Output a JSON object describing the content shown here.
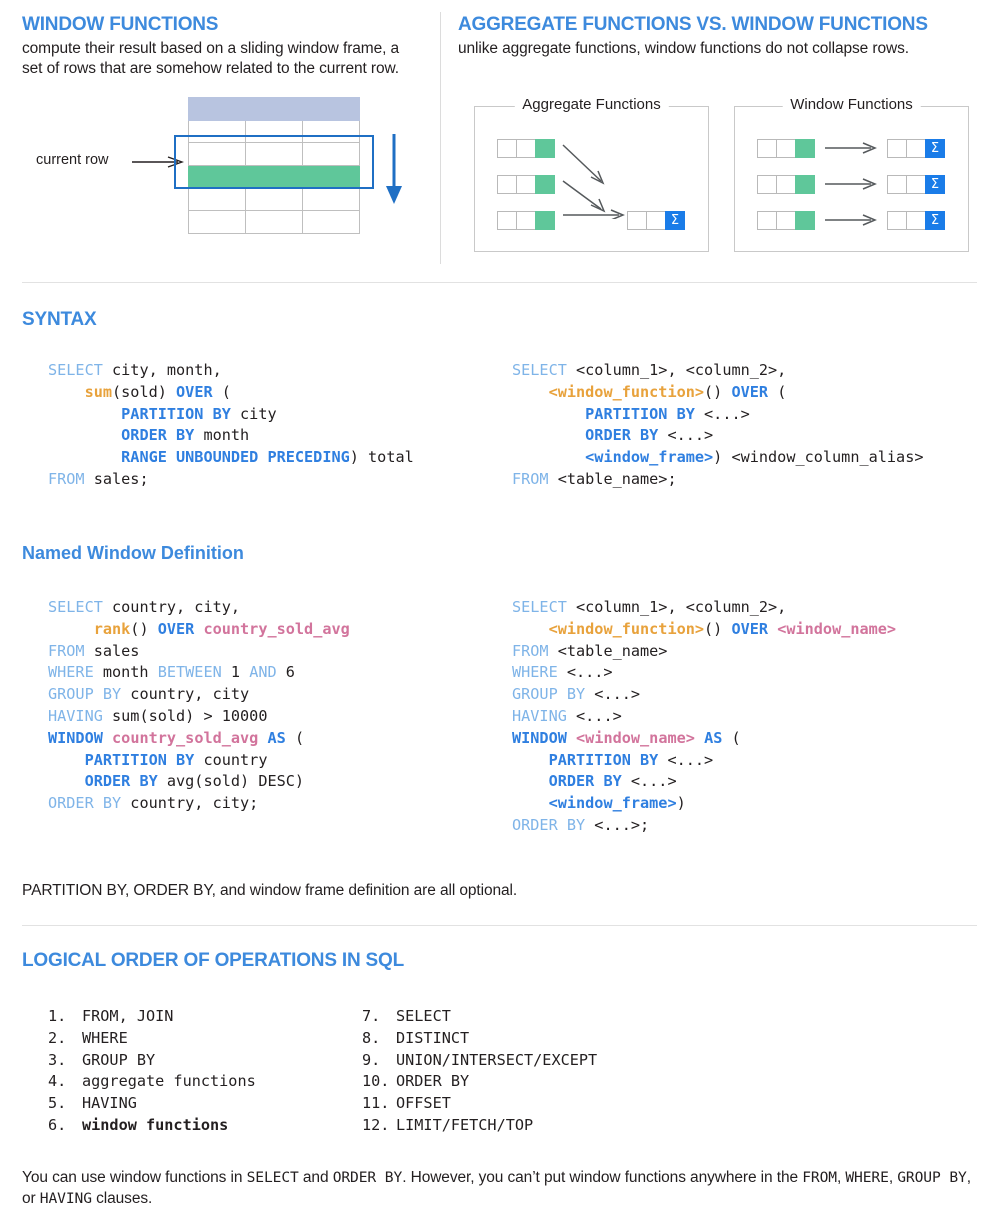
{
  "sections": {
    "window_functions": {
      "title": "WINDOW FUNCTIONS",
      "description": "compute their result based on a sliding window frame, a set of rows that are somehow related to the current row.",
      "diagram": {
        "current_row_label": "current row",
        "row_count": 6,
        "column_count": 3,
        "header_row_index": 0,
        "current_row_index": 3,
        "frame_start_row": 2,
        "frame_end_row": 4,
        "colors": {
          "header": "#b8c4e0",
          "current_row": "#5fc79a",
          "frame_border": "#1f6fc4",
          "grid": "#bfbfbf"
        }
      }
    },
    "comparison": {
      "title": "AGGREGATE FUNCTIONS VS. WINDOW FUNCTIONS",
      "description": "unlike aggregate functions, window functions do not collapse rows.",
      "aggregate": {
        "label": "Aggregate Functions",
        "input_rows": 3,
        "output_rows": 1,
        "cells_per_row": 3,
        "green_cell_index": 2,
        "sigma_symbol": "Σ"
      },
      "window": {
        "label": "Window Functions",
        "input_rows": 3,
        "output_rows": 3,
        "cells_per_row": 3,
        "green_cell_index": 2,
        "sigma_symbol": "Σ"
      }
    },
    "syntax": {
      "title": "SYNTAX",
      "example_code": [
        [
          {
            "t": "SELECT",
            "c": "kw"
          },
          {
            "t": " city, month,",
            "c": "plain"
          }
        ],
        [
          {
            "t": "    ",
            "c": "plain"
          },
          {
            "t": "sum",
            "c": "fn"
          },
          {
            "t": "(sold) ",
            "c": "plain"
          },
          {
            "t": "OVER",
            "c": "kwb"
          },
          {
            "t": " (",
            "c": "plain"
          }
        ],
        [
          {
            "t": "        ",
            "c": "plain"
          },
          {
            "t": "PARTITION BY",
            "c": "kwb"
          },
          {
            "t": " city",
            "c": "plain"
          }
        ],
        [
          {
            "t": "        ",
            "c": "plain"
          },
          {
            "t": "ORDER BY",
            "c": "kwb"
          },
          {
            "t": " month",
            "c": "plain"
          }
        ],
        [
          {
            "t": "        ",
            "c": "plain"
          },
          {
            "t": "RANGE UNBOUNDED PRECEDING",
            "c": "kwb"
          },
          {
            "t": ") total",
            "c": "plain"
          }
        ],
        [
          {
            "t": "FROM",
            "c": "kw"
          },
          {
            "t": " sales;",
            "c": "plain"
          }
        ]
      ],
      "template_code": [
        [
          {
            "t": "SELECT",
            "c": "kw"
          },
          {
            "t": " <column_1>, <column_2>,",
            "c": "plain"
          }
        ],
        [
          {
            "t": "    ",
            "c": "plain"
          },
          {
            "t": "<window_function>",
            "c": "fn"
          },
          {
            "t": "() ",
            "c": "plain"
          },
          {
            "t": "OVER",
            "c": "kwb"
          },
          {
            "t": " (",
            "c": "plain"
          }
        ],
        [
          {
            "t": "        ",
            "c": "plain"
          },
          {
            "t": "PARTITION BY",
            "c": "kwb"
          },
          {
            "t": " <...>",
            "c": "plain"
          }
        ],
        [
          {
            "t": "        ",
            "c": "plain"
          },
          {
            "t": "ORDER BY",
            "c": "kwb"
          },
          {
            "t": " <...>",
            "c": "plain"
          }
        ],
        [
          {
            "t": "        ",
            "c": "plain"
          },
          {
            "t": "<window_frame>",
            "c": "kwb"
          },
          {
            "t": ") <window_column_alias>",
            "c": "plain"
          }
        ],
        [
          {
            "t": "FROM",
            "c": "kw"
          },
          {
            "t": " <table_name>;",
            "c": "plain"
          }
        ]
      ]
    },
    "named_window": {
      "title": "Named Window Definition",
      "example_code": [
        [
          {
            "t": "SELECT",
            "c": "kw"
          },
          {
            "t": " country, city,",
            "c": "plain"
          }
        ],
        [
          {
            "t": "     ",
            "c": "plain"
          },
          {
            "t": "rank",
            "c": "fn"
          },
          {
            "t": "() ",
            "c": "plain"
          },
          {
            "t": "OVER",
            "c": "kwb"
          },
          {
            "t": " ",
            "c": "plain"
          },
          {
            "t": "country_sold_avg",
            "c": "wname"
          }
        ],
        [
          {
            "t": "FROM",
            "c": "kw"
          },
          {
            "t": " sales",
            "c": "plain"
          }
        ],
        [
          {
            "t": "WHERE",
            "c": "kw"
          },
          {
            "t": " month ",
            "c": "plain"
          },
          {
            "t": "BETWEEN",
            "c": "kw"
          },
          {
            "t": " 1 ",
            "c": "plain"
          },
          {
            "t": "AND",
            "c": "kw"
          },
          {
            "t": " 6",
            "c": "plain"
          }
        ],
        [
          {
            "t": "GROUP BY",
            "c": "kw"
          },
          {
            "t": " country, city",
            "c": "plain"
          }
        ],
        [
          {
            "t": "HAVING",
            "c": "kw"
          },
          {
            "t": " sum(sold) > 10000",
            "c": "plain"
          }
        ],
        [
          {
            "t": "WINDOW",
            "c": "kwb"
          },
          {
            "t": " ",
            "c": "plain"
          },
          {
            "t": "country_sold_avg",
            "c": "wname"
          },
          {
            "t": " ",
            "c": "plain"
          },
          {
            "t": "AS",
            "c": "kwb"
          },
          {
            "t": " (",
            "c": "plain"
          }
        ],
        [
          {
            "t": "    ",
            "c": "plain"
          },
          {
            "t": "PARTITION BY",
            "c": "kwb"
          },
          {
            "t": " country",
            "c": "plain"
          }
        ],
        [
          {
            "t": "    ",
            "c": "plain"
          },
          {
            "t": "ORDER BY",
            "c": "kwb"
          },
          {
            "t": " avg(sold) DESC)",
            "c": "plain"
          }
        ],
        [
          {
            "t": "ORDER BY",
            "c": "kw"
          },
          {
            "t": " country, city;",
            "c": "plain"
          }
        ]
      ],
      "template_code": [
        [
          {
            "t": "SELECT",
            "c": "kw"
          },
          {
            "t": " <column_1>, <column_2>,",
            "c": "plain"
          }
        ],
        [
          {
            "t": "    ",
            "c": "plain"
          },
          {
            "t": "<window_function>",
            "c": "fn"
          },
          {
            "t": "() ",
            "c": "plain"
          },
          {
            "t": "OVER",
            "c": "kwb"
          },
          {
            "t": " ",
            "c": "plain"
          },
          {
            "t": "<window_name>",
            "c": "wname"
          }
        ],
        [
          {
            "t": "FROM",
            "c": "kw"
          },
          {
            "t": " <table_name>",
            "c": "plain"
          }
        ],
        [
          {
            "t": "WHERE",
            "c": "kw"
          },
          {
            "t": " <...>",
            "c": "plain"
          }
        ],
        [
          {
            "t": "GROUP BY",
            "c": "kw"
          },
          {
            "t": " <...>",
            "c": "plain"
          }
        ],
        [
          {
            "t": "HAVING",
            "c": "kw"
          },
          {
            "t": " <...>",
            "c": "plain"
          }
        ],
        [
          {
            "t": "WINDOW",
            "c": "kwb"
          },
          {
            "t": " ",
            "c": "plain"
          },
          {
            "t": "<window_name>",
            "c": "wname"
          },
          {
            "t": " ",
            "c": "plain"
          },
          {
            "t": "AS",
            "c": "kwb"
          },
          {
            "t": " (",
            "c": "plain"
          }
        ],
        [
          {
            "t": "    ",
            "c": "plain"
          },
          {
            "t": "PARTITION BY",
            "c": "kwb"
          },
          {
            "t": " <...>",
            "c": "plain"
          }
        ],
        [
          {
            "t": "    ",
            "c": "plain"
          },
          {
            "t": "ORDER BY",
            "c": "kwb"
          },
          {
            "t": " <...>",
            "c": "plain"
          }
        ],
        [
          {
            "t": "    ",
            "c": "plain"
          },
          {
            "t": "<window_frame>",
            "c": "kwb"
          },
          {
            "t": ")",
            "c": "plain"
          }
        ],
        [
          {
            "t": "ORDER BY",
            "c": "kw"
          },
          {
            "t": " <...>;",
            "c": "plain"
          }
        ]
      ],
      "optional_note": "PARTITION BY, ORDER BY, and window frame definition are all optional."
    },
    "logical_order": {
      "title": "LOGICAL ORDER OF OPERATIONS IN SQL",
      "left_items": [
        {
          "num": "1.",
          "label": "FROM, JOIN",
          "bold": false
        },
        {
          "num": "2.",
          "label": "WHERE",
          "bold": false
        },
        {
          "num": "3.",
          "label": "GROUP BY",
          "bold": false
        },
        {
          "num": "4.",
          "label": "aggregate functions",
          "bold": false
        },
        {
          "num": "5.",
          "label": "HAVING",
          "bold": false
        },
        {
          "num": "6.",
          "label": "window functions",
          "bold": true
        }
      ],
      "right_items": [
        {
          "num": "7.",
          "label": "SELECT",
          "bold": false
        },
        {
          "num": "8.",
          "label": "DISTINCT",
          "bold": false
        },
        {
          "num": "9.",
          "label": "UNION/INTERSECT/EXCEPT",
          "bold": false
        },
        {
          "num": "10.",
          "label": "ORDER BY",
          "bold": false
        },
        {
          "num": "11.",
          "label": "OFFSET",
          "bold": false
        },
        {
          "num": "12.",
          "label": "LIMIT/FETCH/TOP",
          "bold": false
        }
      ],
      "footer": [
        {
          "t": "You can use window functions in ",
          "mono": false
        },
        {
          "t": "SELECT",
          "mono": true
        },
        {
          "t": " and ",
          "mono": false
        },
        {
          "t": "ORDER BY",
          "mono": true
        },
        {
          "t": ". However, you can’t put window functions anywhere in the ",
          "mono": false
        },
        {
          "t": "FROM",
          "mono": true
        },
        {
          "t": ", ",
          "mono": false
        },
        {
          "t": "WHERE",
          "mono": true
        },
        {
          "t": ", ",
          "mono": false
        },
        {
          "t": "GROUP BY",
          "mono": true
        },
        {
          "t": ", or ",
          "mono": false
        },
        {
          "t": "HAVING",
          "mono": true
        },
        {
          "t": " clauses.",
          "mono": false
        }
      ]
    }
  },
  "colors": {
    "heading_blue": "#3d8add",
    "keyword_light": "#7fb4e8",
    "keyword_bold": "#2f7fe0",
    "function_orange": "#e8a23c",
    "window_name_pink": "#d2749c",
    "green_cell": "#5fc79a",
    "sigma_blue": "#1a7ce8",
    "header_lavender": "#b8c4e0"
  }
}
